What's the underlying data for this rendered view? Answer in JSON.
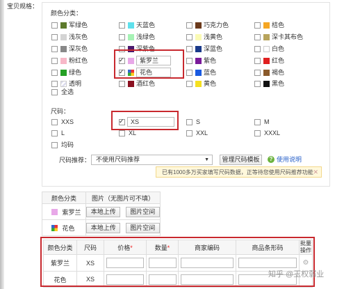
{
  "section_label": "宝贝规格：",
  "color_title": "颜色分类：",
  "colors": [
    {
      "label": "军绿色",
      "color": "#5d7a2c",
      "checked": false
    },
    {
      "label": "天蓝色",
      "color": "#5fe0ec",
      "checked": false
    },
    {
      "label": "巧克力色",
      "color": "#6b3a1c",
      "checked": false
    },
    {
      "label": "桔色",
      "color": "#f5a623",
      "checked": false
    },
    {
      "label": "浅灰色",
      "color": "#d4d4d4",
      "checked": false
    },
    {
      "label": "浅绿色",
      "color": "#a6f2b5",
      "checked": false
    },
    {
      "label": "浅黄色",
      "color": "#fafab4",
      "checked": false
    },
    {
      "label": "深卡其布色",
      "color": "#b8a45c",
      "checked": false
    },
    {
      "label": "深灰色",
      "color": "#888888",
      "checked": false
    },
    {
      "label": "深紫色",
      "color": "#4b1a6e",
      "checked": false
    },
    {
      "label": "深蓝色",
      "color": "#1a3a8a",
      "checked": false
    },
    {
      "label": "白色",
      "color": "#ffffff",
      "checked": false
    },
    {
      "label": "粉红色",
      "color": "#f7b8c8",
      "checked": false
    },
    {
      "label": "紫罗兰",
      "color": "#e8a8e8",
      "checked": true,
      "editable": true
    },
    {
      "label": "紫色",
      "color": "#7a1a9a",
      "checked": false
    },
    {
      "label": "红色",
      "color": "#e02020",
      "checked": false
    },
    {
      "label": "绿色",
      "color": "#24a024",
      "checked": false
    },
    {
      "label": "花色",
      "color": "multi",
      "checked": true,
      "editable": true
    },
    {
      "label": "蓝色",
      "color": "#1a5ae0",
      "checked": false
    },
    {
      "label": "褐色",
      "color": "#8a5a2a",
      "checked": false
    },
    {
      "label": "透明",
      "color": "transparent",
      "checked": false
    },
    {
      "label": "酒红色",
      "color": "#8a1020",
      "checked": false
    },
    {
      "label": "黄色",
      "color": "#f5e020",
      "checked": false
    },
    {
      "label": "黑色",
      "color": "#111111",
      "checked": false
    }
  ],
  "select_all": "全选",
  "size_title": "尺码：",
  "sizes": [
    {
      "label": "XXS",
      "checked": false
    },
    {
      "label": "XS",
      "checked": true,
      "editable": true
    },
    {
      "label": "S",
      "checked": false
    },
    {
      "label": "M",
      "checked": false
    },
    {
      "label": "L",
      "checked": false
    },
    {
      "label": "XL",
      "checked": false
    },
    {
      "label": "XXL",
      "checked": false
    },
    {
      "label": "XXXL",
      "checked": false
    },
    {
      "label": "均码",
      "checked": false
    }
  ],
  "size_recommend_label": "尺码推荐：",
  "size_recommend_value": "不使用尺码推荐",
  "manage_template_btn": "管理尺码模板",
  "help_link": "使用说明",
  "notice_text": "已有1000多万买家填写尺码数据，正等待您使用尺码推荐功能",
  "image_table": {
    "headers": [
      "颜色分类",
      "图片（无图片可不填）"
    ],
    "rows": [
      {
        "name": "紫罗兰",
        "swatch": "#e8a8e8",
        "upload": "本地上传",
        "space": "图片空间"
      },
      {
        "name": "花色",
        "swatch": "multi",
        "upload": "本地上传",
        "space": "图片空间"
      }
    ]
  },
  "sku_table": {
    "headers": [
      "颜色分类",
      "尺码",
      "价格",
      "数量",
      "商家编码",
      "商品条形码",
      "批量操作"
    ],
    "required_mark": "*",
    "rows": [
      {
        "color": "紫罗兰",
        "size": "XS"
      },
      {
        "color": "花色",
        "size": "XS"
      }
    ]
  },
  "watermark": "知乎 @玉权弱业"
}
